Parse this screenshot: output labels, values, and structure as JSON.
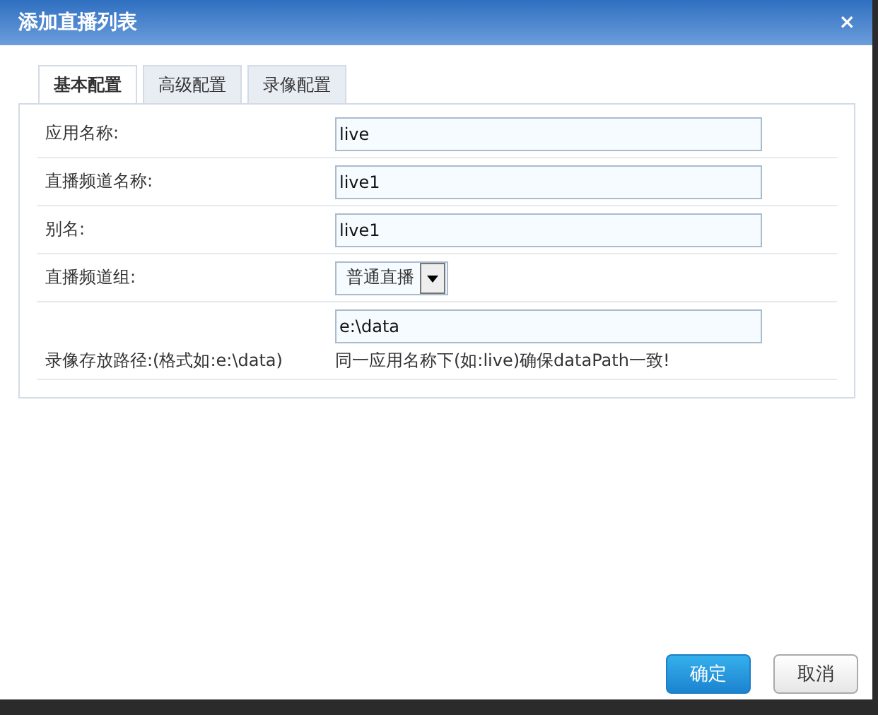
{
  "window": {
    "title": "添加直播列表",
    "close": "×"
  },
  "tabs": [
    {
      "label": "基本配置",
      "selected": true
    },
    {
      "label": "高级配置",
      "selected": false
    },
    {
      "label": "录像配置",
      "selected": false
    }
  ],
  "fields": [
    {
      "kind": "text",
      "label": "应用名称:",
      "value": "live"
    },
    {
      "kind": "text",
      "label": "直播频道名称:",
      "value": "live1"
    },
    {
      "kind": "text",
      "label": "别名:",
      "value": "live1"
    },
    {
      "kind": "select",
      "label": "直播频道组:",
      "value": "普通直播"
    },
    {
      "kind": "text_hint",
      "label": "录像存放路径:(格式如:e:\\data)",
      "value": "e:\\data",
      "hint": "同一应用名称下(如:live)确保dataPath一致!"
    }
  ],
  "buttons": [
    {
      "label": "确定",
      "kind": "primary"
    },
    {
      "label": "取消",
      "kind": "secondary"
    }
  ]
}
